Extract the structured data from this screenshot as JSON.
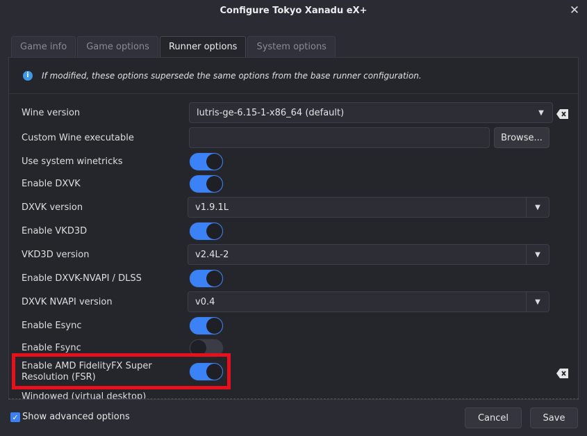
{
  "window": {
    "title": "Configure Tokyo Xanadu eX+"
  },
  "tabs": [
    {
      "label": "Game info"
    },
    {
      "label": "Game options"
    },
    {
      "label": "Runner options"
    },
    {
      "label": "System options"
    }
  ],
  "info": {
    "text": "If modified, these options supersede the same options from the base runner configuration."
  },
  "options": {
    "wine_version": {
      "label": "Wine version",
      "value": "lutris-ge-6.15-1-x86_64 (default)"
    },
    "custom_wine": {
      "label": "Custom Wine executable",
      "value": "",
      "browse_label": "Browse..."
    },
    "system_winetricks": {
      "label": "Use system winetricks",
      "enabled": true
    },
    "enable_dxvk": {
      "label": "Enable DXVK",
      "enabled": true
    },
    "dxvk_version": {
      "label": "DXVK version",
      "value": "v1.9.1L"
    },
    "enable_vkd3d": {
      "label": "Enable VKD3D",
      "enabled": true
    },
    "vkd3d_version": {
      "label": "VKD3D version",
      "value": "v2.4L-2"
    },
    "enable_dxvk_nvapi": {
      "label": "Enable DXVK-NVAPI / DLSS",
      "enabled": true
    },
    "dxvk_nvapi_version": {
      "label": "DXVK NVAPI version",
      "value": "v0.4"
    },
    "enable_esync": {
      "label": "Enable Esync",
      "enabled": true
    },
    "enable_fsync": {
      "label": "Enable Fsync",
      "enabled": false
    },
    "enable_fsr": {
      "label_line1": "Enable AMD FidelityFX Super",
      "label_line2": "Resolution (FSR)",
      "enabled": true
    },
    "windowed": {
      "label": "Windowed (virtual desktop)"
    }
  },
  "footer": {
    "show_advanced_label": "Show advanced options",
    "show_advanced_checked": true,
    "cancel_label": "Cancel",
    "save_label": "Save"
  },
  "colors": {
    "accent": "#3b82f6",
    "highlight": "#e8101a",
    "background": "#2b2c33"
  }
}
